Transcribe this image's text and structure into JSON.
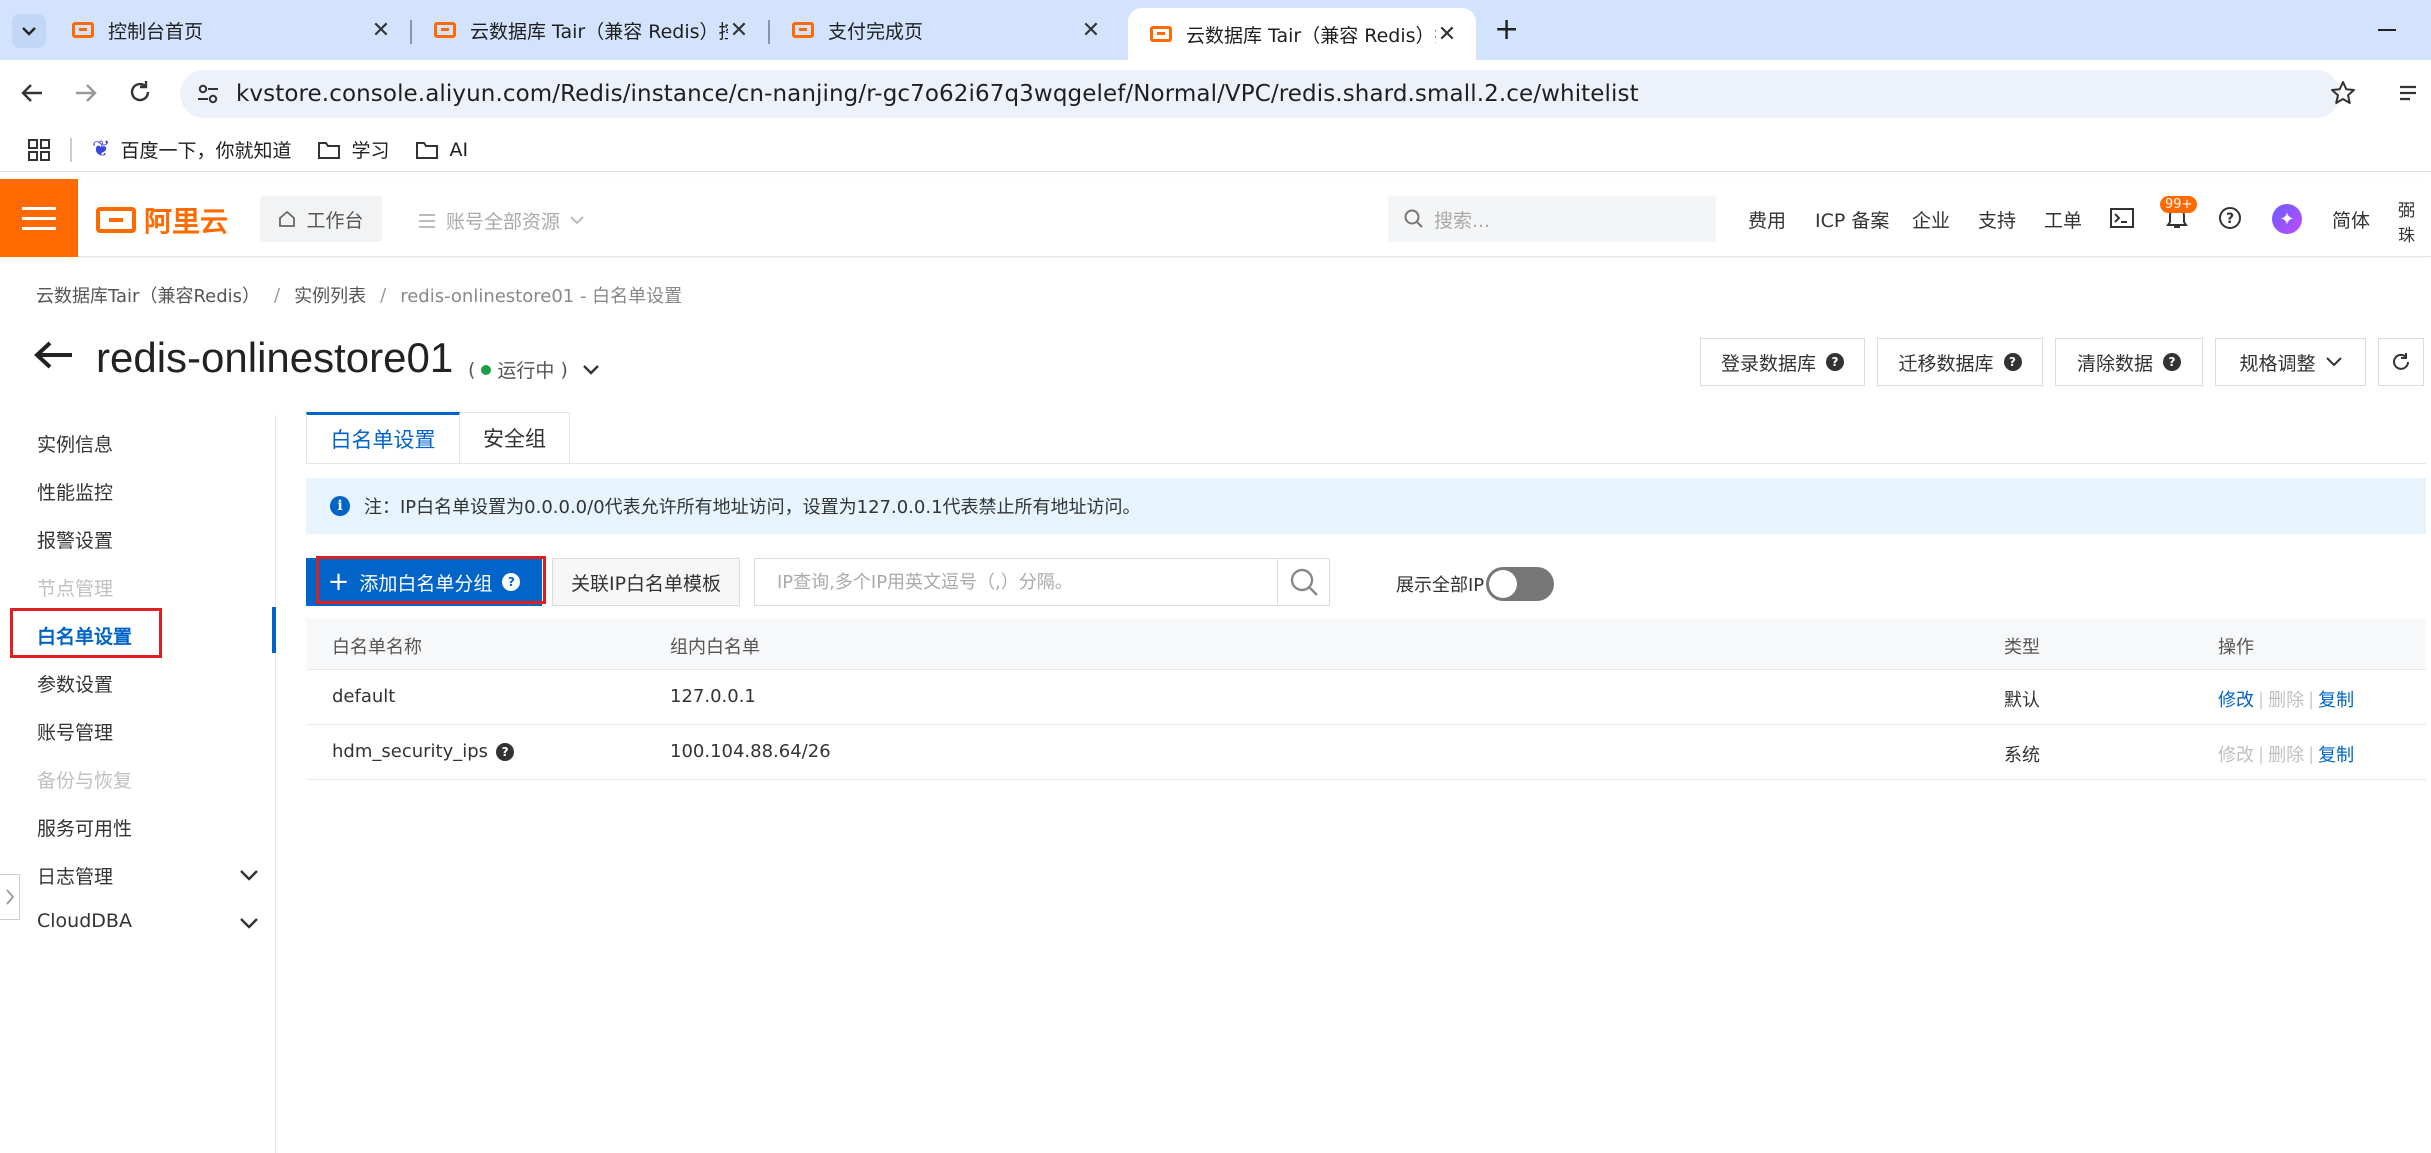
{
  "browser": {
    "tabs": [
      {
        "title": "控制台首页"
      },
      {
        "title": "云数据库 Tair（兼容 Redis）控"
      },
      {
        "title": "支付完成页"
      },
      {
        "title": "云数据库 Tair（兼容 Redis）控"
      }
    ],
    "new_tab": "+",
    "url": "kvstore.console.aliyun.com/Redis/instance/cn-nanjing/r-gc7o62i67q3wqgelef/Normal/VPC/redis.shard.small.2.ce/whitelist",
    "bookmarks": [
      "百度一下，你就知道",
      "学习",
      "AI"
    ]
  },
  "console": {
    "logo": "阿里云",
    "workbench": "工作台",
    "account_resources": "账号全部资源",
    "search_placeholder": "搜索...",
    "links": [
      "费用",
      "ICP 备案",
      "企业",
      "支持",
      "工单"
    ],
    "badge": "99+",
    "lang": "简体",
    "user": "弼珠"
  },
  "breadcrumb": [
    "云数据库Tair（兼容Redis）",
    "实例列表",
    "redis-onlinestore01 - 白名单设置"
  ],
  "page": {
    "title": "redis-onlinestore01",
    "status": "运行中",
    "paren_open": "(",
    "paren_close": ")",
    "actions": [
      "登录数据库",
      "迁移数据库",
      "清除数据",
      "规格调整"
    ]
  },
  "nav": [
    {
      "label": "实例信息",
      "state": "normal"
    },
    {
      "label": "性能监控",
      "state": "normal"
    },
    {
      "label": "报警设置",
      "state": "normal"
    },
    {
      "label": "节点管理",
      "state": "disabled"
    },
    {
      "label": "白名单设置",
      "state": "active"
    },
    {
      "label": "参数设置",
      "state": "normal"
    },
    {
      "label": "账号管理",
      "state": "normal"
    },
    {
      "label": "备份与恢复",
      "state": "disabled"
    },
    {
      "label": "服务可用性",
      "state": "normal"
    },
    {
      "label": "日志管理",
      "state": "expandable"
    },
    {
      "label": "CloudDBA",
      "state": "expandable"
    }
  ],
  "subtabs": [
    "白名单设置",
    "安全组"
  ],
  "notice": "注：IP白名单设置为0.0.0.0/0代表允许所有地址访问，设置为127.0.0.1代表禁止所有地址访问。",
  "toolbar": {
    "add_label": "添加白名单分组",
    "template_label": "关联IP白名单模板",
    "ip_placeholder": "IP查询,多个IP用英文逗号（,）分隔。",
    "show_all_label": "展示全部IP"
  },
  "table": {
    "columns": [
      "白名单名称",
      "组内白名单",
      "类型",
      "操作"
    ],
    "rows": [
      {
        "name": "default",
        "ips": "127.0.0.1",
        "type": "默认",
        "ops": [
          "修改",
          "删除",
          "复制"
        ]
      },
      {
        "name": "hdm_security_ips",
        "ips": "100.104.88.64/26",
        "type": "系统",
        "ops": [
          "修改",
          "删除",
          "复制"
        ]
      }
    ]
  },
  "colors": {
    "accent": "#0064c8",
    "brand": "#ff6a00",
    "status_running": "#1a9e4a",
    "highlight": "#e02020"
  }
}
